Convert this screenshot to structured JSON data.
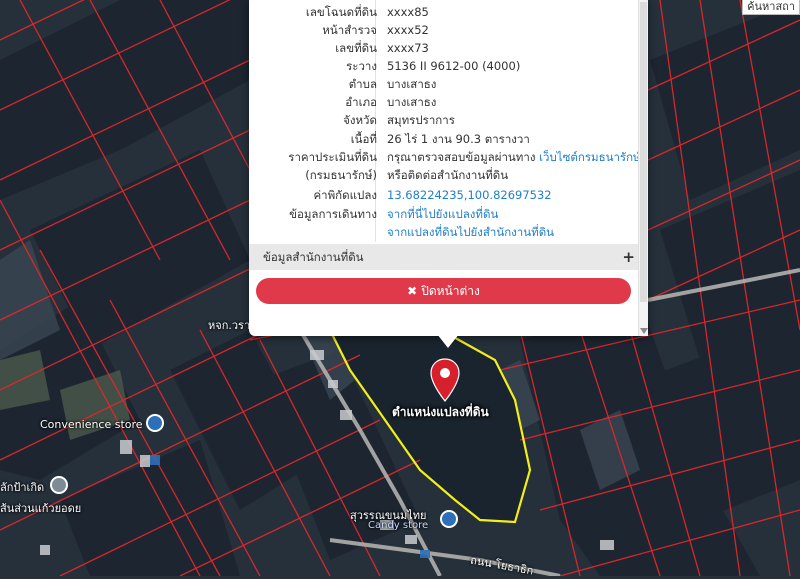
{
  "search_tab": {
    "label": "ค้นหาสถา"
  },
  "popup": {
    "rows": [
      {
        "key": "เลขโฉนดที่ดิน",
        "value": "xxxx85"
      },
      {
        "key": "หน้าสำรวจ",
        "value": "xxxx52"
      },
      {
        "key": "เลขที่ดิน",
        "value": "xxxx73"
      },
      {
        "key": "ระวาง",
        "value": "5136 II 9612-00 (4000)"
      },
      {
        "key": "ตำบล",
        "value": "บางเสาธง"
      },
      {
        "key": "อำเภอ",
        "value": "บางเสาธง"
      },
      {
        "key": "จังหวัด",
        "value": "สมุทรปราการ"
      },
      {
        "key": "เนื้อที่",
        "value": "26 ไร่ 1 งาน 90.3 ตารางวา"
      }
    ],
    "price": {
      "key1": "ราคาประเมินที่ดิน",
      "key2": "(กรมธนารักษ์)",
      "text": "กรุณาตรวจสอบข้อมูลผ่านทาง",
      "link": "เว็บไซต์กรมธนารักษ์",
      "text2": "หรือติดต่อสำนักงานที่ดิน"
    },
    "coords": {
      "key": "ค่าพิกัดแปลง",
      "value": "13.68224235,100.82697532"
    },
    "travel": {
      "key": "ข้อมูลการเดินทาง",
      "link1": "จากที่นี่ไปยังแปลงที่ดิน",
      "link2": "จากแปลงที่ดินไปยังสำนักงานที่ดิน"
    },
    "office_section": {
      "label": "ข้อมูลสำนักงานที่ดิน",
      "toggle": "+"
    },
    "close_button": {
      "icon": "✖",
      "label": "ปิดหน้าต่าง"
    }
  },
  "map": {
    "marker_label": "ตำแหน่งแปลงที่ดิน",
    "road_label_1": "หจก.วรา",
    "poi_convenience": "Convenience store",
    "poi_left_1": "ลักป้าเกิด",
    "poi_left_2": "ส้นส่วนแก้วยอดย",
    "poi_candy_1": "สุวรรณขนมไทย",
    "poi_candy_2": "Candy store",
    "road_bottom": "ถนน โยธาธิก",
    "colors": {
      "parcel_line": "#e0282c",
      "highlight": "#f2ee1c",
      "marker": "#d7202c",
      "close_button": "#e03a4a",
      "link": "#1f7ec9"
    },
    "icons": [
      "map-marker-icon",
      "shop-icon",
      "candy-store-icon",
      "pin-icon"
    ]
  }
}
